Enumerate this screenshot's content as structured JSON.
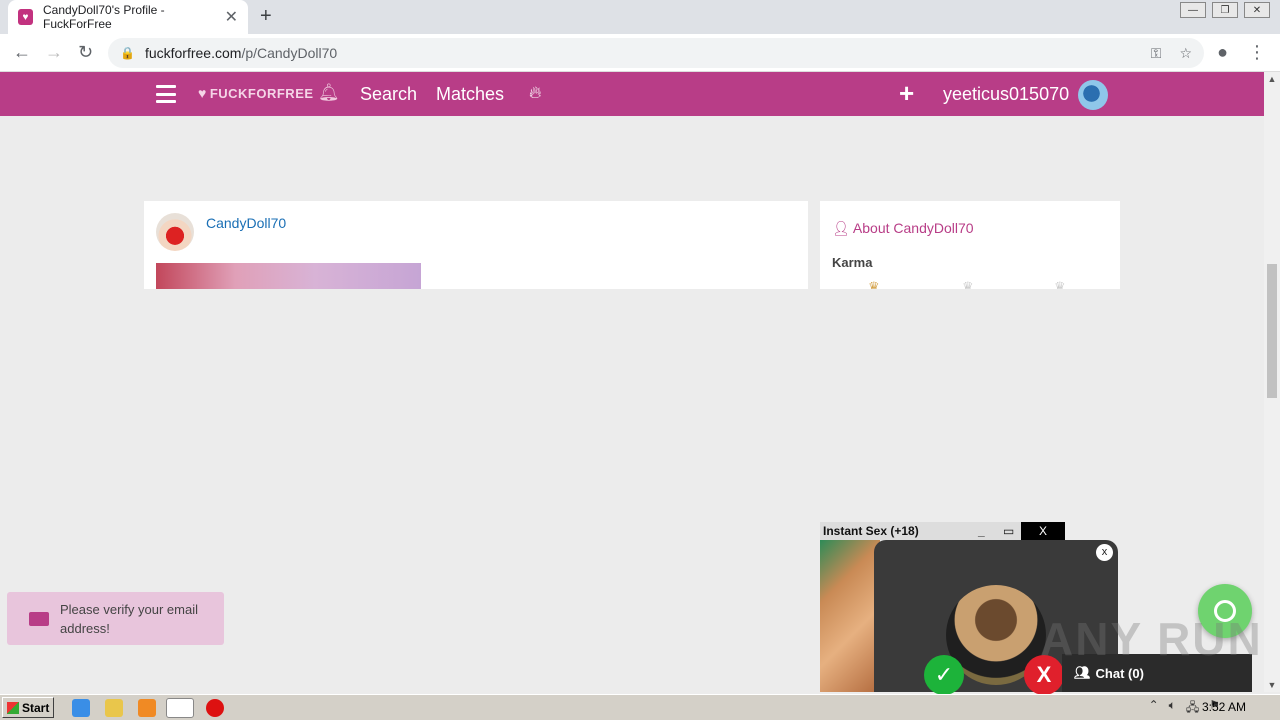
{
  "browser": {
    "tab_title": "CandyDoll70's Profile - FuckForFree",
    "url_host": "fuckforfree.com",
    "url_path": "/p/CandyDoll70"
  },
  "site_nav": {
    "logo_text": "FUCKFORFREE",
    "search_label": "Search",
    "matches_label": "Matches",
    "username": "yeeticus015070",
    "brand_color": "#b83d87"
  },
  "profile": {
    "name": "CandyDoll70",
    "about_heading": "About CandyDoll70",
    "karma_label": "Karma"
  },
  "toast": {
    "message": "Please verify your email address!"
  },
  "popup": {
    "title": "Instant Sex (+18)",
    "close_label": "X",
    "card_close": "x",
    "accept_symbol": "✓",
    "decline_symbol": "X",
    "chat_label": "Chat (0)"
  },
  "watermark": "ANY RUN",
  "taskbar": {
    "start_label": "Start",
    "time": "3:52 AM"
  }
}
